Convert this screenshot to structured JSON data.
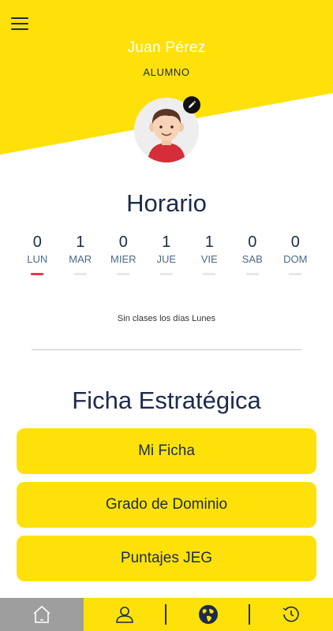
{
  "header": {
    "user_name": "Juan Pérez",
    "user_role": "ALUMNO",
    "colors": {
      "background": "#ffe10a",
      "name_text": "#ffffff"
    },
    "icons": {
      "menu": "hamburger-menu-icon",
      "avatar": "boy-avatar",
      "edit": "pencil-icon"
    }
  },
  "horario": {
    "title": "Horario",
    "days": [
      {
        "count": "0",
        "label": "LUN",
        "active": true
      },
      {
        "count": "1",
        "label": "MAR",
        "active": false
      },
      {
        "count": "0",
        "label": "MIER",
        "active": false
      },
      {
        "count": "1",
        "label": "JUE",
        "active": false
      },
      {
        "count": "1",
        "label": "VIE",
        "active": false
      },
      {
        "count": "0",
        "label": "SAB",
        "active": false
      },
      {
        "count": "0",
        "label": "DOM",
        "active": false
      }
    ],
    "message": "Sin clases los días Lunes",
    "active_color": "#e8384f"
  },
  "ficha": {
    "title": "Ficha Estratégica",
    "buttons": [
      {
        "label": "Mi Ficha"
      },
      {
        "label": "Grado de Dominio"
      },
      {
        "label": "Puntajes JEG"
      }
    ]
  },
  "bottom_nav": {
    "items": [
      {
        "icon": "home-icon",
        "active": true
      },
      {
        "icon": "user-icon",
        "active": false
      },
      {
        "icon": "globe-icon",
        "active": false
      },
      {
        "icon": "history-clock-icon",
        "active": false
      }
    ]
  }
}
